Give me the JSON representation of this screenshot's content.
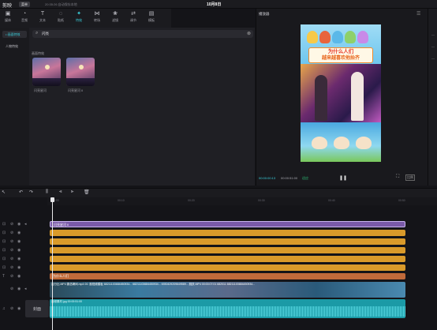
{
  "app": {
    "name": "剪映",
    "menu_label": "菜单",
    "autosave": "20:35:26 自动保存本地",
    "project_date": "10月8日"
  },
  "toolbar": {
    "items": [
      {
        "label": "媒体",
        "icon": "media-icon"
      },
      {
        "label": "音频",
        "icon": "audio-icon"
      },
      {
        "label": "文本",
        "icon": "text-icon"
      },
      {
        "label": "贴纸",
        "icon": "sticker-icon"
      },
      {
        "label": "特效",
        "icon": "effects-icon",
        "active": true
      },
      {
        "label": "转场",
        "icon": "transition-icon"
      },
      {
        "label": "滤镜",
        "icon": "filter-icon"
      },
      {
        "label": "调节",
        "icon": "adjust-icon"
      },
      {
        "label": "模板",
        "icon": "template-icon"
      }
    ]
  },
  "leftnav": {
    "items": [
      {
        "label": "• 画面特效",
        "active": true
      },
      {
        "label": "人物特效",
        "active": false
      }
    ]
  },
  "search": {
    "value": "闪亮",
    "placeholder": ""
  },
  "media": {
    "section": "画面特效",
    "thumbs": [
      {
        "label": "闪亮星河"
      },
      {
        "label": "闪亮星河 II"
      }
    ]
  },
  "player": {
    "title": "播放器",
    "timecode": "00:00:00:13",
    "duration": "00:00:51:00",
    "fit_label": "适应",
    "ratio_label": "比例"
  },
  "video": {
    "banner_line1": "为什么人们",
    "banner_line2": "越来越喜欢他抬齐"
  },
  "timeline": {
    "ruler_ticks": [
      "00:00",
      "00:10",
      "00:20",
      "00:30",
      "00:40",
      "00:50"
    ],
    "clips": [
      {
        "type": "fx",
        "label": "闪亮星河 II"
      },
      {
        "type": "or",
        "label": ""
      },
      {
        "type": "or",
        "label": ""
      },
      {
        "type": "or",
        "label": ""
      },
      {
        "type": "or",
        "label": ""
      },
      {
        "type": "or",
        "label": ""
      },
      {
        "type": "tx",
        "label": "为什么人们"
      }
    ],
    "main_video_label": "百分比.MP4    霸总瞬间.mp4  00:    副视频模板    68211103684450934...  68211103684450934...  6930429209649589...  跳跃.MP4  00:00:07:01    682011    68211103684450934...",
    "audio_label": "音频素材.jpg  00:00:51:00",
    "cover_label": "封面"
  }
}
